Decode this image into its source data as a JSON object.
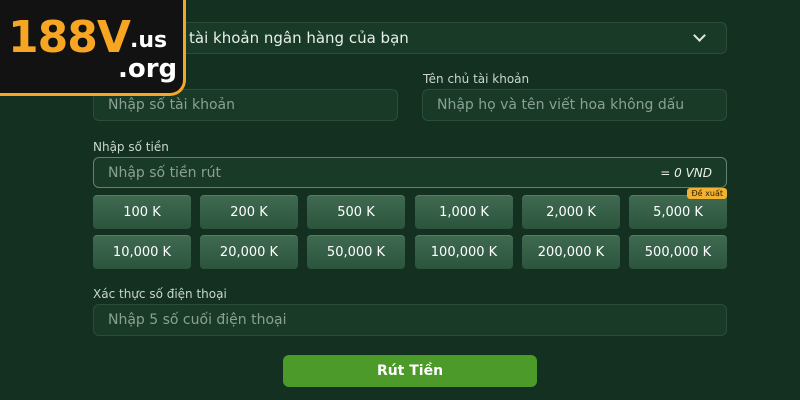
{
  "logo": {
    "main": "188V",
    "dot_us": ".us",
    "dot_org": ".org"
  },
  "bank": {
    "selected": "tài khoản ngân hàng của bạn",
    "icon": "chevron-down-icon"
  },
  "account_name": {
    "label": "Tên chủ tài khoản",
    "placeholder": "Nhập họ và tên viết hoa không dấu"
  },
  "account_number": {
    "placeholder": "Nhập số tài khoản"
  },
  "amount": {
    "label": "Nhập số tiền",
    "placeholder": "Nhập số tiền rút",
    "suffix": "= 0 VND",
    "chips": [
      "100 K",
      "200 K",
      "500 K",
      "1,000 K",
      "2,000 K",
      "5,000 K",
      "10,000 K",
      "20,000 K",
      "50,000 K",
      "100,000 K",
      "200,000 K",
      "500,000 K"
    ],
    "badge": "Đề xuất"
  },
  "phone": {
    "label": "Xác thực số điện thoại",
    "placeholder": "Nhập 5 số cuối điện thoại"
  },
  "submit_label": "Rút Tiền",
  "colors": {
    "background": "#143020",
    "accent": "#f6a623",
    "button": "#4c9a2a"
  }
}
